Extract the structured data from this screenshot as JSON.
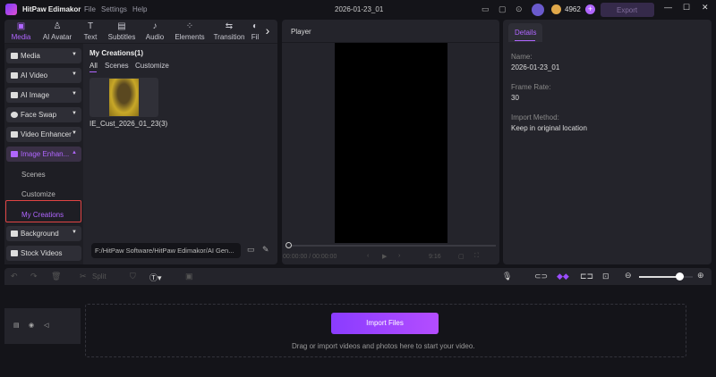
{
  "app": {
    "title": "HitPaw Edimakor",
    "menu": [
      "File",
      "Settings",
      "Help"
    ],
    "project_name": "2026-01-23_01",
    "credits": "4962",
    "export_label": "Export"
  },
  "toolbar_tabs": [
    {
      "label": "Media",
      "icon": "media-icon",
      "active": true
    },
    {
      "label": "AI Avatar",
      "icon": "avatar-icon"
    },
    {
      "label": "Text",
      "icon": "text-icon"
    },
    {
      "label": "Subtitles",
      "icon": "subtitles-icon"
    },
    {
      "label": "Audio",
      "icon": "audio-icon"
    },
    {
      "label": "Elements",
      "icon": "elements-icon"
    },
    {
      "label": "Transition",
      "icon": "transition-icon"
    },
    {
      "label": "Fil",
      "icon": "filter-icon"
    }
  ],
  "sidebar": {
    "items": [
      "Media",
      "AI Video",
      "AI Image",
      "Face Swap",
      "Video Enhancer",
      "Image Enhan..."
    ],
    "sub_items": [
      "Scenes",
      "Customize",
      "My Creations"
    ],
    "bottom_items": [
      "Background",
      "Stock Videos"
    ]
  },
  "content": {
    "title": "My Creations(1)",
    "filters": [
      "All",
      "Scenes",
      "Customize"
    ],
    "file_name": "IE_Cust_2026_01_23(3)",
    "path": "F:/HitPaw Software/HitPaw Edimakor/AI Gen..."
  },
  "player": {
    "title": "Player",
    "time": "00:00:00 / 00:00:00",
    "ratio": "9:16"
  },
  "details": {
    "tab": "Details",
    "name_label": "Name:",
    "name": "2026-01-23_01",
    "frame_rate_label": "Frame Rate:",
    "frame_rate": "30",
    "import_label": "Import Method:",
    "import_method": "Keep in original location"
  },
  "timeline": {
    "split_label": "Split",
    "import_button": "Import Files",
    "hint": "Drag or import videos and photos here to start your video.",
    "zoom_level": 0.75
  },
  "colors": {
    "accent": "#9b4dff",
    "highlight_box": "#e04444"
  }
}
